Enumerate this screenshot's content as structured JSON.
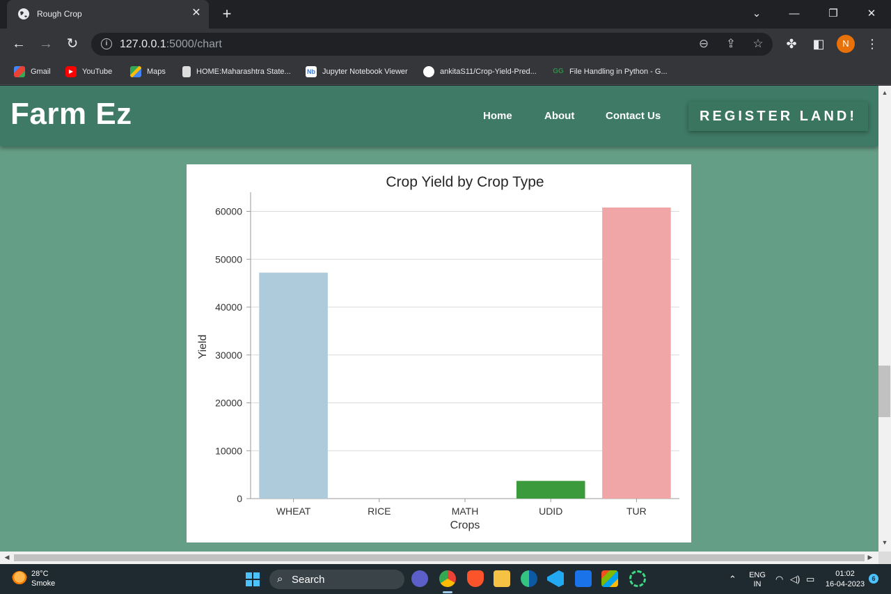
{
  "browser": {
    "tab_title": "Rough Crop",
    "url_host": "127.0.0.1",
    "url_path": ":5000/chart",
    "profile_initial": "N",
    "bookmarks": [
      {
        "label": "Gmail",
        "icon": "gmail-icon",
        "color": "#ea4335"
      },
      {
        "label": "YouTube",
        "icon": "youtube-icon",
        "color": "#ff0000"
      },
      {
        "label": "Maps",
        "icon": "maps-icon",
        "color": "#34a853"
      },
      {
        "label": "HOME:Maharashtra State...",
        "icon": "site-icon",
        "color": "#dddddd"
      },
      {
        "label": "Jupyter Notebook Viewer",
        "icon": "nbviewer-icon",
        "color": "#3c78d8"
      },
      {
        "label": "ankitaS11/Crop-Yield-Pred...",
        "icon": "github-icon",
        "color": "#ffffff"
      },
      {
        "label": "File Handling in Python - G...",
        "icon": "gfg-icon",
        "color": "#2f8d46"
      }
    ]
  },
  "site": {
    "brand": "Farm Ez",
    "nav": {
      "home": "Home",
      "about": "About",
      "contact": "Contact Us"
    },
    "register": "REGISTER LAND!"
  },
  "chart_data": {
    "type": "bar",
    "title": "Crop Yield by Crop Type",
    "xlabel": "Crops",
    "ylabel": "Yield",
    "categories": [
      "WHEAT",
      "RICE",
      "MATH",
      "UDID",
      "TUR"
    ],
    "values": [
      47200,
      0,
      0,
      3700,
      60800
    ],
    "colors": [
      "#aecbdc",
      "#5b9bd5",
      "#b2df8a",
      "#3b9a3b",
      "#f0a6a6"
    ],
    "ylim": [
      0,
      64000
    ],
    "yticks": [
      0,
      10000,
      20000,
      30000,
      40000,
      50000,
      60000
    ],
    "grid": true
  },
  "taskbar": {
    "weather_temp": "28°C",
    "weather_desc": "Smoke",
    "search": "Search",
    "lang_top": "ENG",
    "lang_bottom": "IN",
    "time": "01:02",
    "date": "16-04-2023",
    "notifications": "6"
  }
}
